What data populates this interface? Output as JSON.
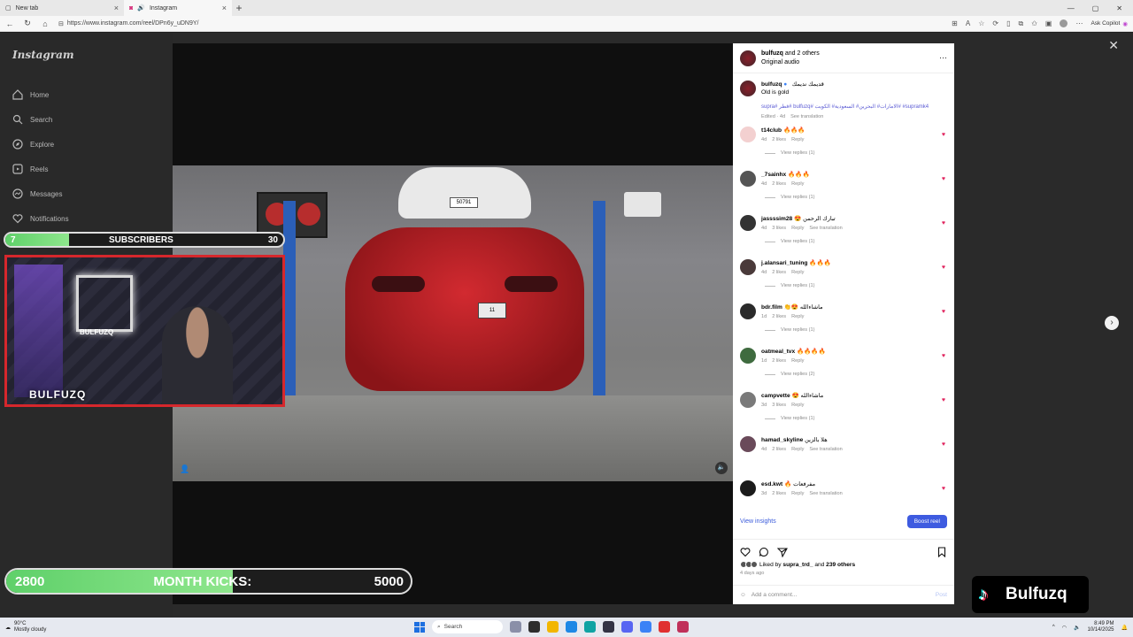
{
  "browser": {
    "tabs": [
      {
        "label": "New tab",
        "active": false
      },
      {
        "label": "Instagram",
        "active": true
      }
    ],
    "url": "https://www.instagram.com/reel/DPn6y_uDN9Y/",
    "copilot_label": "Ask Copilot"
  },
  "instagram": {
    "logo": "Instagram",
    "nav": [
      {
        "label": "Home",
        "icon": "home-icon"
      },
      {
        "label": "Search",
        "icon": "search-icon"
      },
      {
        "label": "Explore",
        "icon": "compass-icon"
      },
      {
        "label": "Reels",
        "icon": "reels-icon"
      },
      {
        "label": "Messages",
        "icon": "messenger-icon"
      },
      {
        "label": "Notifications",
        "icon": "heart-icon"
      }
    ]
  },
  "video": {
    "plate_text": "50791",
    "plate_text_red": "11"
  },
  "panel": {
    "header_user": "bulfuzq",
    "header_others": " and 2 others",
    "header_audio": "Original audio",
    "caption_user": "bulfuzq",
    "caption_arabic": "قديمك نديمك",
    "caption_text": "Old is gold",
    "caption_hashtags": "supra# قطر# bulfuzq# الامارات# البحرين# السعودية# الكويت# #supramk4",
    "caption_meta_time": "Edited · 4d",
    "caption_meta_translate": "See translation",
    "comments": [
      {
        "user": "t14club",
        "text": "🔥🔥🔥",
        "time": "4d",
        "likes": "2 likes",
        "reply": "Reply",
        "translate": "",
        "replies": "View replies (1)"
      },
      {
        "user": "_7sainhx",
        "text": "🔥🔥🔥",
        "time": "4d",
        "likes": "2 likes",
        "reply": "Reply",
        "translate": "",
        "replies": "View replies (1)"
      },
      {
        "user": "jassssim28",
        "text": "😍 تبارك الرحمن",
        "time": "4d",
        "likes": "3 likes",
        "reply": "Reply",
        "translate": "See translation",
        "replies": "View replies (1)"
      },
      {
        "user": "j.alansari_tuning",
        "text": "🔥🔥🔥",
        "time": "4d",
        "likes": "2 likes",
        "reply": "Reply",
        "translate": "",
        "replies": "View replies (1)"
      },
      {
        "user": "bdr.film",
        "text": "👏😍 ماشاءالله",
        "time": "1d",
        "likes": "2 likes",
        "reply": "Reply",
        "translate": "",
        "replies": "View replies (1)"
      },
      {
        "user": "oatmeal_tvx",
        "text": "🔥🔥🔥🔥",
        "time": "1d",
        "likes": "2 likes",
        "reply": "Reply",
        "translate": "",
        "replies": "View replies (2)"
      },
      {
        "user": "campvette",
        "text": "😍 ماشاءالله",
        "time": "3d",
        "likes": "3 likes",
        "reply": "Reply",
        "translate": "",
        "replies": "View replies (1)"
      },
      {
        "user": "hamad_skyline",
        "text": "هلا بالزين",
        "time": "4d",
        "likes": "2 likes",
        "reply": "Reply",
        "translate": "See translation",
        "replies": ""
      },
      {
        "user": "esd.kwt",
        "text": "🔥 مفرفعات",
        "time": "3d",
        "likes": "2 likes",
        "reply": "Reply",
        "translate": "See translation",
        "replies": ""
      }
    ],
    "view_insights": "View insights",
    "boost_label": "Boost reel",
    "liked_by_prefix": "Liked by ",
    "liked_by_user": "supra_trd_",
    "liked_by_suffix": " and ",
    "liked_by_others": "239 others",
    "post_date": "4 days ago",
    "add_comment_placeholder": "Add a comment...",
    "post_label": "Post"
  },
  "overlays": {
    "subscribers_current": "7",
    "subscribers_label": "SUBSCRIBERS",
    "subscribers_goal": "30",
    "subscribers_progress": 0.23,
    "cam_name": "BULFUZQ",
    "neon_text": "BULFUZQ",
    "kicks_current": "2800",
    "kicks_label": "MONTH KICKS:",
    "kicks_goal": "5000",
    "kicks_progress": 0.56,
    "tiktok_name": "Bulfuzq"
  },
  "taskbar": {
    "temp": "90°C",
    "weather": "Mostly cloudy",
    "search": "Search",
    "time": "8:49 PM",
    "date": "10/14/2025"
  },
  "colors": {
    "accent_blue": "#3e5be0",
    "heart_red": "#e0245e",
    "progress_green": "#6ad86f"
  }
}
